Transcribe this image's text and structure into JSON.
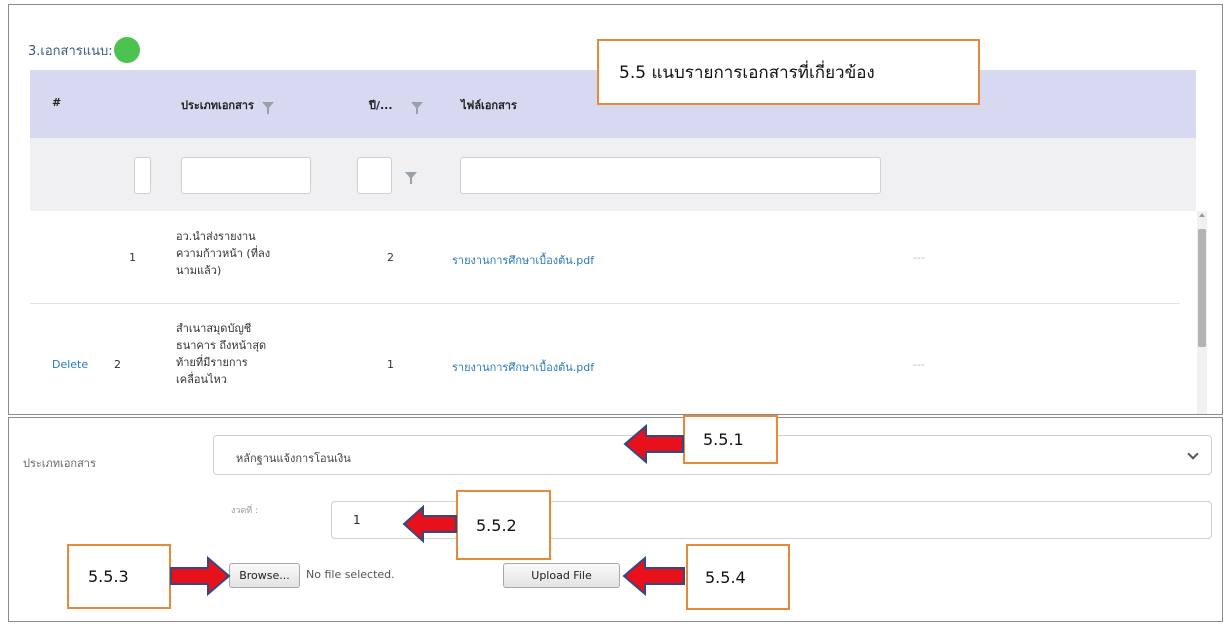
{
  "top": {
    "section_title": "3.เอกสารแนบ:",
    "headers": {
      "index": "#",
      "doc_type": "ประเภทเอกสาร",
      "period": "ปี/...",
      "file": "ไฟล์เอกสาร"
    },
    "rows": [
      {
        "action": "",
        "index": "1",
        "doc_type_lines": [
          "อว.นำส่งรายงาน",
          "ความก้าวหน้า (ที่ลง",
          "นามแล้ว)"
        ],
        "period": "2",
        "file": "รายงานการศึกษาเบื้องต้น.pdf",
        "extra": "---"
      },
      {
        "action": "Delete",
        "index": "2",
        "doc_type_lines": [
          "สำเนาสมุดบัญชี",
          "ธนาคาร ถึงหน้าสุด",
          "ท้ายที่มีรายการ",
          "เคลื่อนไหว"
        ],
        "period": "1",
        "file": "รายงานการศึกษาเบื้องต้น.pdf",
        "extra": "---"
      }
    ],
    "callout_main": "5.5 แนบรายการเอกสารที่เกี่ยวข้อง"
  },
  "bottom": {
    "doc_type_label": "ประเภทเอกสาร",
    "doc_type_value": "หลักฐานแจ้งการโอนเงิน",
    "installment_label": "งวดที่ :",
    "installment_value": "1",
    "browse_label": "Browse...",
    "no_file_text": "No file selected.",
    "upload_label": "Upload File",
    "callouts": {
      "c551": "5.5.1",
      "c552": "5.5.2",
      "c553": "5.5.3",
      "c554": "5.5.4"
    }
  },
  "colors": {
    "header_bg": "#d7d9f1",
    "filter_bg": "#f0f0f2",
    "callout_border": "#e58a3a",
    "arrow_fill": "#e8111b",
    "arrow_stroke": "#2f4a86",
    "status_dot": "#4cc250",
    "link": "#2a7ab8"
  },
  "icons": {
    "filter": "filter-icon",
    "status": "green-dot-icon",
    "dropdown": "chevron-down-icon",
    "pointer": "red-arrow-icon"
  }
}
